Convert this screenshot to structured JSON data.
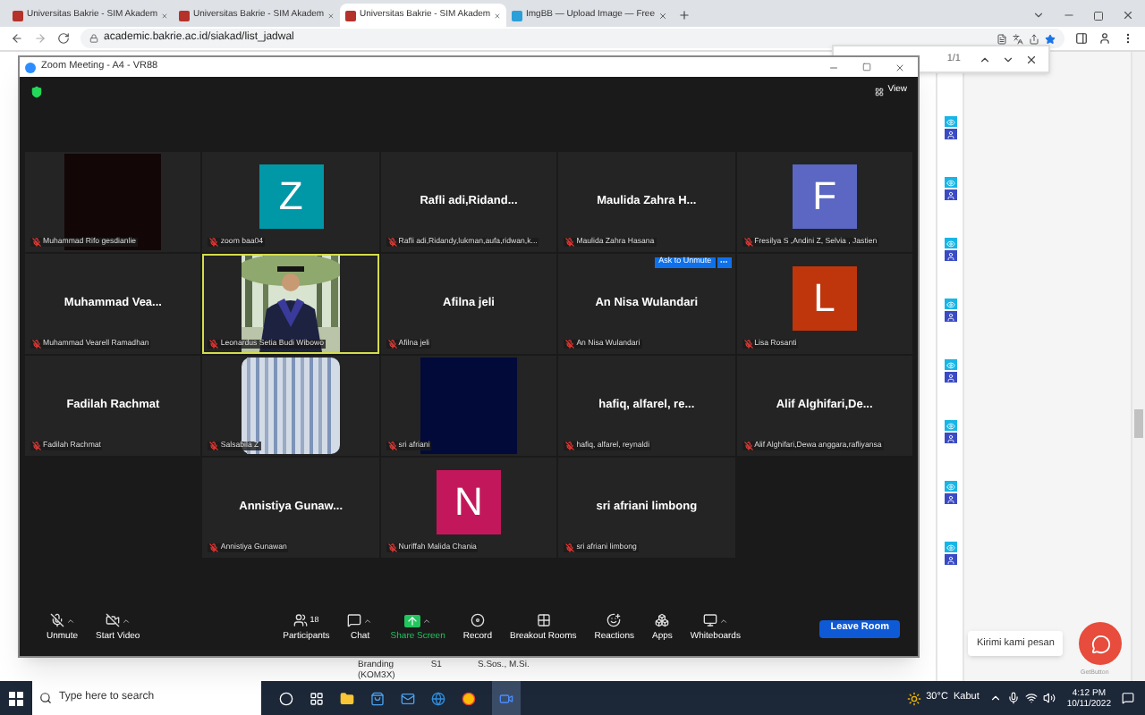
{
  "browser": {
    "tabs": [
      {
        "title": "Universitas Bakrie - SIM Akadem",
        "selected": false
      },
      {
        "title": "Universitas Bakrie - SIM Akadem",
        "selected": false
      },
      {
        "title": "Universitas Bakrie - SIM Akadem",
        "selected": true
      },
      {
        "title": "ImgBB — Upload Image — Free",
        "selected": false
      }
    ],
    "url": "academic.bakrie.ac.id/siakad/list_jadwal"
  },
  "find_bar": {
    "count": "1/1"
  },
  "page_table": {
    "cells": [
      "Branding",
      "(KOM3X)",
      "S1",
      "S.Sos., M.Si."
    ]
  },
  "zoom": {
    "title": "Zoom Meeting - A4 - VR88",
    "view_label": "View",
    "tiles": [
      {
        "kind": "blank",
        "color": "#120606",
        "caption": "Muhammad Rifo gesdianlie",
        "active_speaker": false
      },
      {
        "kind": "avatar",
        "display": "Z",
        "color": "#0097a7",
        "caption": "zoom baa04",
        "active_speaker": false
      },
      {
        "kind": "name",
        "display": "Rafli  adi,Ridand...",
        "caption": "Rafli adi,Ridandy,lukman,aufa,ridwan,k...",
        "active_speaker": false
      },
      {
        "kind": "name",
        "display": "Maulida Zahra H...",
        "caption": "Maulida Zahra Hasana",
        "active_speaker": false
      },
      {
        "kind": "avatar",
        "display": "F",
        "color": "#5b67c2",
        "caption": "Fresilya S ,Andini Z, Selvia , Jastien",
        "active_speaker": false
      },
      {
        "kind": "name",
        "display": "Muhammad  Vea...",
        "caption": "Muhammad Vearell Ramadhan",
        "active_speaker": false
      },
      {
        "kind": "camera",
        "caption": "Leonardus Setia Budi Wibowo",
        "active_speaker": true
      },
      {
        "kind": "name",
        "display": "Afilna jeli",
        "caption": "Afilna jeli",
        "active_speaker": false
      },
      {
        "kind": "name",
        "display": "An Nisa Wulandari",
        "caption": "An Nisa Wulandari",
        "active_speaker": false,
        "ask_unmute": "Ask to Unmute"
      },
      {
        "kind": "avatar",
        "display": "L",
        "color": "#bf360c",
        "caption": "Lisa Rosanti",
        "active_speaker": false
      },
      {
        "kind": "name",
        "display": "Fadilah Rachmat",
        "caption": "Fadilah Rachmat",
        "active_speaker": false
      },
      {
        "kind": "camera",
        "caption": "Salsabila Z",
        "active_speaker": false
      },
      {
        "kind": "blank",
        "color": "#020a3a",
        "caption": "sri afriani",
        "active_speaker": false
      },
      {
        "kind": "name",
        "display": "hafiq,  alfarel,  re...",
        "caption": "hafiq, alfarel, reynaldi",
        "active_speaker": false
      },
      {
        "kind": "name",
        "display": "Alif  Alghifari,De...",
        "caption": "Alif Alghifari,Dewa anggara,rafliyansa",
        "active_speaker": false
      },
      {
        "kind": "empty"
      },
      {
        "kind": "name",
        "display": "Annistiya  Gunaw...",
        "caption": "Annistiya Gunawan",
        "active_speaker": false
      },
      {
        "kind": "avatar",
        "display": "N",
        "color": "#c2185b",
        "caption": "Nuriffah Malida Chania",
        "active_speaker": false
      },
      {
        "kind": "name",
        "display": "sri afriani limbong",
        "caption": "sri afriani limbong",
        "active_speaker": false
      },
      {
        "kind": "empty"
      }
    ],
    "toolbar": [
      {
        "kind": "mute",
        "label": "Unmute"
      },
      {
        "kind": "video",
        "label": "Start Video"
      },
      {
        "kind": "participants",
        "label": "Participants",
        "count": "18"
      },
      {
        "kind": "chat",
        "label": "Chat"
      },
      {
        "kind": "share",
        "label": "Share Screen"
      },
      {
        "kind": "record",
        "label": "Record"
      },
      {
        "kind": "breakout",
        "label": "Breakout Rooms"
      },
      {
        "kind": "reactions",
        "label": "Reactions"
      },
      {
        "kind": "apps",
        "label": "Apps"
      },
      {
        "kind": "whiteboards",
        "label": "Whiteboards"
      }
    ],
    "leave_label": "Leave Room"
  },
  "chat_widget": {
    "tooltip": "Kirimi kami pesan",
    "brand": "GetButton"
  },
  "taskbar": {
    "search_placeholder": "Type here to search",
    "weather": "30°C  Kabut",
    "time": "4:12 PM",
    "date": "10/11/2022"
  }
}
